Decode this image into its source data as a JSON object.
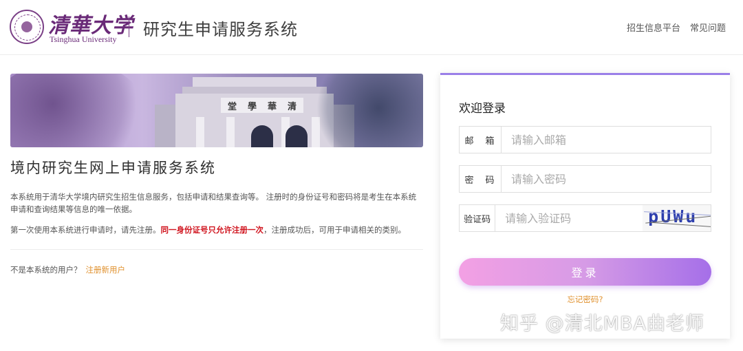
{
  "header": {
    "logo_cn": "清華大学",
    "logo_en": "Tsinghua University",
    "system_title": "研究生申请服务系统",
    "nav": [
      "招生信息平台",
      "常见问题"
    ]
  },
  "banner": {
    "plaque_chars": [
      "堂",
      "學",
      "華",
      "清"
    ]
  },
  "main": {
    "heading": "境内研究生网上申请服务系统",
    "intro": "本系统用于清华大学境内研究生招生信息服务，包括申请和结果查询等。 注册时的身份证号和密码将是考生在本系统申请和查询结果等信息的唯一依据。",
    "notice_before": "第一次使用本系统进行申请时，请先注册。",
    "notice_highlight": "同一身份证号只允许注册一次",
    "notice_after": "，注册成功后，可用于申请相关的类别。",
    "register_prompt": "不是本系统的用户？",
    "register_link": "注册新用户"
  },
  "login": {
    "title": "欢迎登录",
    "email_label": "邮　箱",
    "email_placeholder": "请输入邮箱",
    "password_label": "密　码",
    "password_placeholder": "请输入密码",
    "captcha_label": "验证码",
    "captcha_placeholder": "请输入验证码",
    "captcha_text": "pUWu",
    "submit": "登录",
    "forgot": "忘记密码?"
  },
  "watermark": "知乎 @清北MBA曲老师",
  "colors": {
    "brand_purple": "#6a2a78",
    "accent_orange": "#e0912e",
    "warning_red": "#d0141e",
    "button_gradient_start": "#f3a0e4",
    "button_gradient_end": "#a56fe8"
  }
}
